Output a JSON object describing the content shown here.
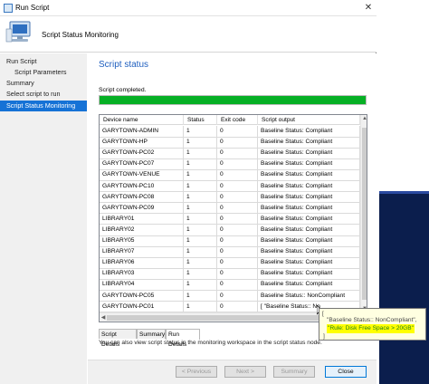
{
  "window": {
    "title": "Run Script",
    "close_glyph": "✕",
    "header_title": "Script Status Monitoring"
  },
  "sidebar": {
    "items": [
      {
        "label": "Run Script"
      },
      {
        "label": "Script Parameters"
      },
      {
        "label": "Summary"
      },
      {
        "label": "Select script to run"
      },
      {
        "label": "Script Status Monitoring"
      }
    ]
  },
  "content": {
    "title": "Script status",
    "completed_text": "Script completed.",
    "progress_fraction": 1.0,
    "info_text": "You can also view script status in the monitoring workspace in the script status node."
  },
  "grid": {
    "columns": [
      "Device name",
      "Status",
      "Exit code",
      "Script output"
    ],
    "rows": [
      [
        "GARYTOWN-ADMIN",
        "1",
        "0",
        "Baseline Status: Compliant"
      ],
      [
        "GARYTOWN-HP",
        "1",
        "0",
        "Baseline Status: Compliant"
      ],
      [
        "GARYTOWN-PC02",
        "1",
        "0",
        "Baseline Status: Compliant"
      ],
      [
        "GARYTOWN-PC07",
        "1",
        "0",
        "Baseline Status: Compliant"
      ],
      [
        "GARYTOWN-VENUE",
        "1",
        "0",
        "Baseline Status: Compliant"
      ],
      [
        "GARYTOWN-PC10",
        "1",
        "0",
        "Baseline Status: Compliant"
      ],
      [
        "GARYTOWN-PC08",
        "1",
        "0",
        "Baseline Status: Compliant"
      ],
      [
        "GARYTOWN-PC09",
        "1",
        "0",
        "Baseline Status: Compliant"
      ],
      [
        "LIBRARY01",
        "1",
        "0",
        "Baseline Status: Compliant"
      ],
      [
        "LIBRARY02",
        "1",
        "0",
        "Baseline Status: Compliant"
      ],
      [
        "LIBRARY05",
        "1",
        "0",
        "Baseline Status: Compliant"
      ],
      [
        "LIBRARY07",
        "1",
        "0",
        "Baseline Status: Compliant"
      ],
      [
        "LIBRARY06",
        "1",
        "0",
        "Baseline Status: Compliant"
      ],
      [
        "LIBRARY03",
        "1",
        "0",
        "Baseline Status: Compliant"
      ],
      [
        "LIBRARY04",
        "1",
        "0",
        "Baseline Status: Compliant"
      ],
      [
        "GARYTOWN-PC05",
        "1",
        "0",
        "Baseline Status:: NonCompliant"
      ],
      [
        "GARYTOWN-PC01",
        "1",
        "0",
        "[  \"Baseline Status:: No"
      ]
    ]
  },
  "tabs": [
    "Script Details",
    "Summary",
    "Run Details"
  ],
  "tooltip": {
    "line1": "\"Baseline Status:: NonCompliant\",",
    "line2": "\"Rule: Disk Free Space > 20GB\"",
    "line3": "]",
    "bracket": "["
  },
  "footer": {
    "previous": "< Previous",
    "next": "Next >",
    "summary": "Summary",
    "close": "Close"
  },
  "colors": {
    "accent": "#1672d6",
    "progress": "#06b025",
    "title_blue": "#1f5fbf",
    "desktop_navy": "#0b1e4d"
  }
}
